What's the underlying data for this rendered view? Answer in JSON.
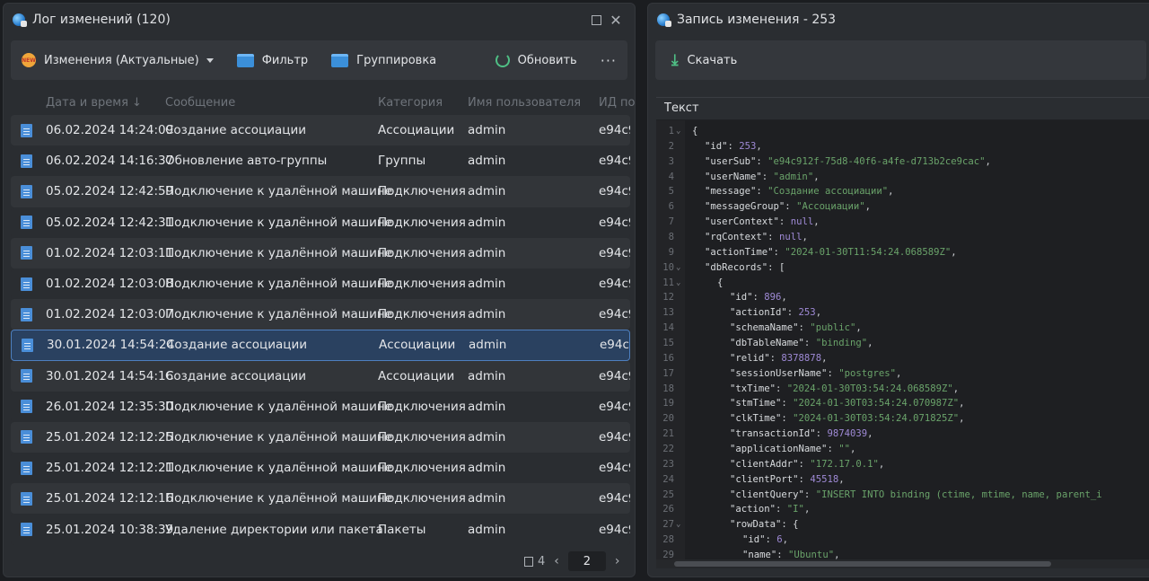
{
  "left_window": {
    "title": "Лог изменений (120)",
    "toolbar": {
      "view_label": "Изменения (Актуальные)",
      "filter_label": "Фильтр",
      "group_label": "Группировка",
      "refresh_label": "Обновить",
      "more_label": "···"
    },
    "columns": {
      "date": "Дата и время ↓",
      "message": "Сообщение",
      "category": "Категория",
      "user": "Имя пользователя",
      "id": "ИД по"
    },
    "rows": [
      {
        "date": "06.02.2024 14:24:09",
        "message": "Создание ассоциации",
        "category": "Ассоциации",
        "user": "admin",
        "id": "e94c9"
      },
      {
        "date": "06.02.2024 14:16:37",
        "message": "Обновление авто-группы",
        "category": "Группы",
        "user": "admin",
        "id": "e94c9"
      },
      {
        "date": "05.02.2024 12:42:59",
        "message": "Подключение к удалённой машине",
        "category": "Подключения",
        "user": "admin",
        "id": "e94c9"
      },
      {
        "date": "05.02.2024 12:42:31",
        "message": "Подключение к удалённой машине",
        "category": "Подключения",
        "user": "admin",
        "id": "e94c9"
      },
      {
        "date": "01.02.2024 12:03:11",
        "message": "Подключение к удалённой машине",
        "category": "Подключения",
        "user": "admin",
        "id": "e94c9"
      },
      {
        "date": "01.02.2024 12:03:08",
        "message": "Подключение к удалённой машине",
        "category": "Подключения",
        "user": "admin",
        "id": "e94c9"
      },
      {
        "date": "01.02.2024 12:03:07",
        "message": "Подключение к удалённой машине",
        "category": "Подключения",
        "user": "admin",
        "id": "e94c9"
      },
      {
        "date": "30.01.2024 14:54:24",
        "message": "Создание ассоциации",
        "category": "Ассоциации",
        "user": "admin",
        "id": "e94c9"
      },
      {
        "date": "30.01.2024 14:54:16",
        "message": "Создание ассоциации",
        "category": "Ассоциации",
        "user": "admin",
        "id": "e94c9"
      },
      {
        "date": "26.01.2024 12:35:30",
        "message": "Подключение к удалённой машине",
        "category": "Подключения",
        "user": "admin",
        "id": "e94c9"
      },
      {
        "date": "25.01.2024 12:12:25",
        "message": "Подключение к удалённой машине",
        "category": "Подключения",
        "user": "admin",
        "id": "e94c9"
      },
      {
        "date": "25.01.2024 12:12:21",
        "message": "Подключение к удалённой машине",
        "category": "Подключения",
        "user": "admin",
        "id": "e94c9"
      },
      {
        "date": "25.01.2024 12:12:16",
        "message": "Подключение к удалённой машине",
        "category": "Подключения",
        "user": "admin",
        "id": "e94c9"
      },
      {
        "date": "25.01.2024 10:38:39",
        "message": "Удаление директории или пакета",
        "category": "Пакеты",
        "user": "admin",
        "id": "e94c9"
      }
    ],
    "selected_row_index": 7,
    "pager": {
      "page_count": "4",
      "current_page": "2"
    }
  },
  "right_window": {
    "title": "Запись изменения - 253",
    "download_label": "Скачать",
    "text_label": "Текст",
    "code_lines": [
      {
        "n": "1",
        "fold": true,
        "indent": 0,
        "key": "",
        "value": "{",
        "vtype": "p"
      },
      {
        "n": "2",
        "fold": false,
        "indent": 1,
        "key": "\"id\"",
        "value": "253",
        "vtype": "n",
        "trail": ","
      },
      {
        "n": "3",
        "fold": false,
        "indent": 1,
        "key": "\"userSub\"",
        "value": "\"e94c912f-75d8-40f6-a4fe-d713b2ce9cac\"",
        "vtype": "s",
        "trail": ","
      },
      {
        "n": "4",
        "fold": false,
        "indent": 1,
        "key": "\"userName\"",
        "value": "\"admin\"",
        "vtype": "s",
        "trail": ","
      },
      {
        "n": "5",
        "fold": false,
        "indent": 1,
        "key": "\"message\"",
        "value": "\"Создание ассоциации\"",
        "vtype": "s",
        "trail": ","
      },
      {
        "n": "6",
        "fold": false,
        "indent": 1,
        "key": "\"messageGroup\"",
        "value": "\"Ассоциации\"",
        "vtype": "s",
        "trail": ","
      },
      {
        "n": "7",
        "fold": false,
        "indent": 1,
        "key": "\"userContext\"",
        "value": "null",
        "vtype": "n",
        "trail": ","
      },
      {
        "n": "8",
        "fold": false,
        "indent": 1,
        "key": "\"rqContext\"",
        "value": "null",
        "vtype": "n",
        "trail": ","
      },
      {
        "n": "9",
        "fold": false,
        "indent": 1,
        "key": "\"actionTime\"",
        "value": "\"2024-01-30T11:54:24.068589Z\"",
        "vtype": "s",
        "trail": ","
      },
      {
        "n": "10",
        "fold": true,
        "indent": 1,
        "key": "\"dbRecords\"",
        "value": "[",
        "vtype": "p"
      },
      {
        "n": "11",
        "fold": true,
        "indent": 2,
        "key": "",
        "value": "{",
        "vtype": "p"
      },
      {
        "n": "12",
        "fold": false,
        "indent": 3,
        "key": "\"id\"",
        "value": "896",
        "vtype": "n",
        "trail": ","
      },
      {
        "n": "13",
        "fold": false,
        "indent": 3,
        "key": "\"actionId\"",
        "value": "253",
        "vtype": "n",
        "trail": ","
      },
      {
        "n": "14",
        "fold": false,
        "indent": 3,
        "key": "\"schemaName\"",
        "value": "\"public\"",
        "vtype": "s",
        "trail": ","
      },
      {
        "n": "15",
        "fold": false,
        "indent": 3,
        "key": "\"dbTableName\"",
        "value": "\"binding\"",
        "vtype": "s",
        "trail": ","
      },
      {
        "n": "16",
        "fold": false,
        "indent": 3,
        "key": "\"relid\"",
        "value": "8378878",
        "vtype": "n",
        "trail": ","
      },
      {
        "n": "17",
        "fold": false,
        "indent": 3,
        "key": "\"sessionUserName\"",
        "value": "\"postgres\"",
        "vtype": "s",
        "trail": ","
      },
      {
        "n": "18",
        "fold": false,
        "indent": 3,
        "key": "\"txTime\"",
        "value": "\"2024-01-30T03:54:24.068589Z\"",
        "vtype": "s",
        "trail": ","
      },
      {
        "n": "19",
        "fold": false,
        "indent": 3,
        "key": "\"stmTime\"",
        "value": "\"2024-01-30T03:54:24.070987Z\"",
        "vtype": "s",
        "trail": ","
      },
      {
        "n": "20",
        "fold": false,
        "indent": 3,
        "key": "\"clkTime\"",
        "value": "\"2024-01-30T03:54:24.071825Z\"",
        "vtype": "s",
        "trail": ","
      },
      {
        "n": "21",
        "fold": false,
        "indent": 3,
        "key": "\"transactionId\"",
        "value": "9874039",
        "vtype": "n",
        "trail": ","
      },
      {
        "n": "22",
        "fold": false,
        "indent": 3,
        "key": "\"applicationName\"",
        "value": "\"\"",
        "vtype": "s",
        "trail": ","
      },
      {
        "n": "23",
        "fold": false,
        "indent": 3,
        "key": "\"clientAddr\"",
        "value": "\"172.17.0.1\"",
        "vtype": "s",
        "trail": ","
      },
      {
        "n": "24",
        "fold": false,
        "indent": 3,
        "key": "\"clientPort\"",
        "value": "45518",
        "vtype": "n",
        "trail": ","
      },
      {
        "n": "25",
        "fold": false,
        "indent": 3,
        "key": "\"clientQuery\"",
        "value": "\"INSERT INTO binding (ctime, mtime, name, parent_i",
        "vtype": "s"
      },
      {
        "n": "26",
        "fold": false,
        "indent": 3,
        "key": "\"action\"",
        "value": "\"I\"",
        "vtype": "s",
        "trail": ","
      },
      {
        "n": "27",
        "fold": true,
        "indent": 3,
        "key": "\"rowData\"",
        "value": "{",
        "vtype": "p"
      },
      {
        "n": "28",
        "fold": false,
        "indent": 4,
        "key": "\"id\"",
        "value": "6",
        "vtype": "n",
        "trail": ","
      },
      {
        "n": "29",
        "fold": false,
        "indent": 4,
        "key": "\"name\"",
        "value": "\"Ubuntu\"",
        "vtype": "s",
        "trail": ","
      }
    ]
  }
}
